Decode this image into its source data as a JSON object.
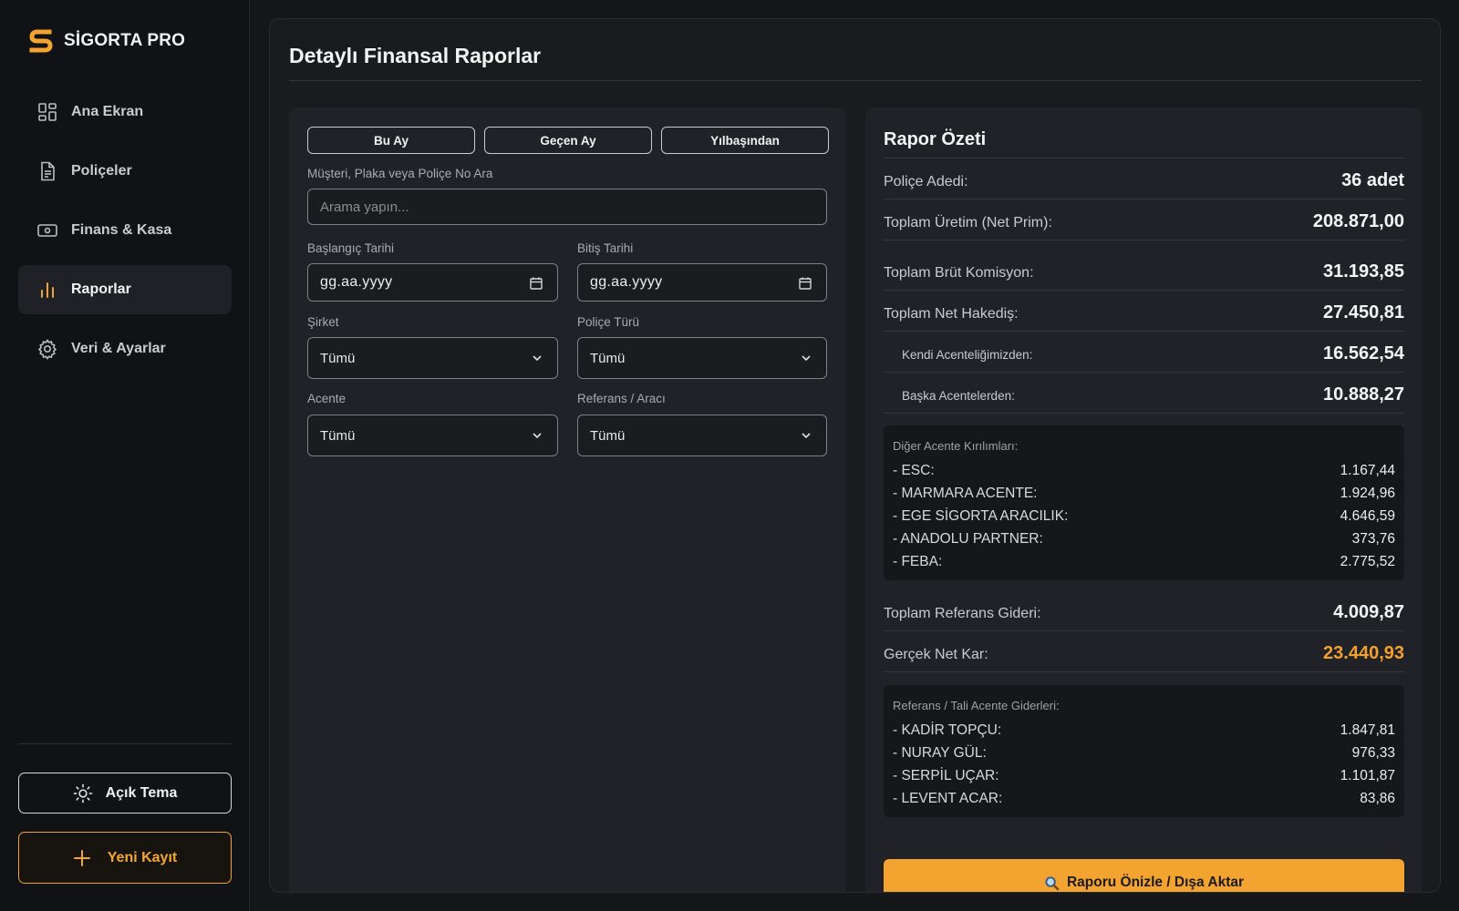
{
  "app": {
    "name": "SİGORTA PRO",
    "accent": "#f2a330"
  },
  "sidebar": {
    "items": [
      {
        "label": "Ana Ekran",
        "icon": "dashboard-icon"
      },
      {
        "label": "Poliçeler",
        "icon": "document-icon"
      },
      {
        "label": "Finans & Kasa",
        "icon": "cash-icon"
      },
      {
        "label": "Raporlar",
        "icon": "bar-chart-icon",
        "active": true
      },
      {
        "label": "Veri & Ayarlar",
        "icon": "gear-icon"
      }
    ],
    "theme_label": "Açık Tema",
    "new_label": "Yeni Kayıt"
  },
  "page": {
    "title": "Detaylı Finansal Raporlar"
  },
  "filters": {
    "quick": [
      "Bu Ay",
      "Geçen Ay",
      "Yılbaşından"
    ],
    "search_label": "Müşteri, Plaka veya Poliçe No Ara",
    "search_placeholder": "Arama yapın...",
    "start_label": "Başlangıç Tarihi",
    "start_value": "gg.aa.yyyy",
    "end_label": "Bitiş Tarihi",
    "end_value": "gg.aa.yyyy",
    "company_label": "Şirket",
    "company_value": "Tümü",
    "policy_type_label": "Poliçe Türü",
    "policy_type_value": "Tümü",
    "agency_label": "Acente",
    "agency_value": "Tümü",
    "reference_label": "Referans / Aracı",
    "reference_value": "Tümü"
  },
  "summary": {
    "title": "Rapor Özeti",
    "policy_count_label": "Poliçe Adedi:",
    "policy_count": "36 adet",
    "production_label": "Toplam Üretim (Net Prim):",
    "production": "208.871,00",
    "gross_commission_label": "Toplam Brüt Komisyon:",
    "gross_commission": "31.193,85",
    "net_earning_label": "Toplam Net Hakediş:",
    "net_earning": "27.450,81",
    "own_agency_label": "Kendi Acenteliğimizden:",
    "own_agency": "16.562,54",
    "other_agencies_label": "Başka Acentelerden:",
    "other_agencies": "10.888,27",
    "other_breakdown_title": "Diğer Acente Kırılımları:",
    "other_breakdown": [
      {
        "name": "- ESC:",
        "value": "1.167,44"
      },
      {
        "name": "- MARMARA ACENTE:",
        "value": "1.924,96"
      },
      {
        "name": "- EGE SİGORTA ARACILIK:",
        "value": "4.646,59"
      },
      {
        "name": "- ANADOLU PARTNER:",
        "value": "373,76"
      },
      {
        "name": "- FEBA:",
        "value": "2.775,52"
      }
    ],
    "reference_expense_label": "Toplam Referans Gideri:",
    "reference_expense": "4.009,87",
    "net_profit_label": "Gerçek Net Kar:",
    "net_profit": "23.440,93",
    "ref_breakdown_title": "Referans / Tali Acente Giderleri:",
    "ref_breakdown": [
      {
        "name": "- KADİR TOPÇU:",
        "value": "1.847,81"
      },
      {
        "name": "- NURAY GÜL:",
        "value": "976,33"
      },
      {
        "name": "- SERPİL UÇAR:",
        "value": "1.101,87"
      },
      {
        "name": "- LEVENT ACAR:",
        "value": "83,86"
      }
    ],
    "export_label": "Raporu Önizle / Dışa Aktar"
  }
}
